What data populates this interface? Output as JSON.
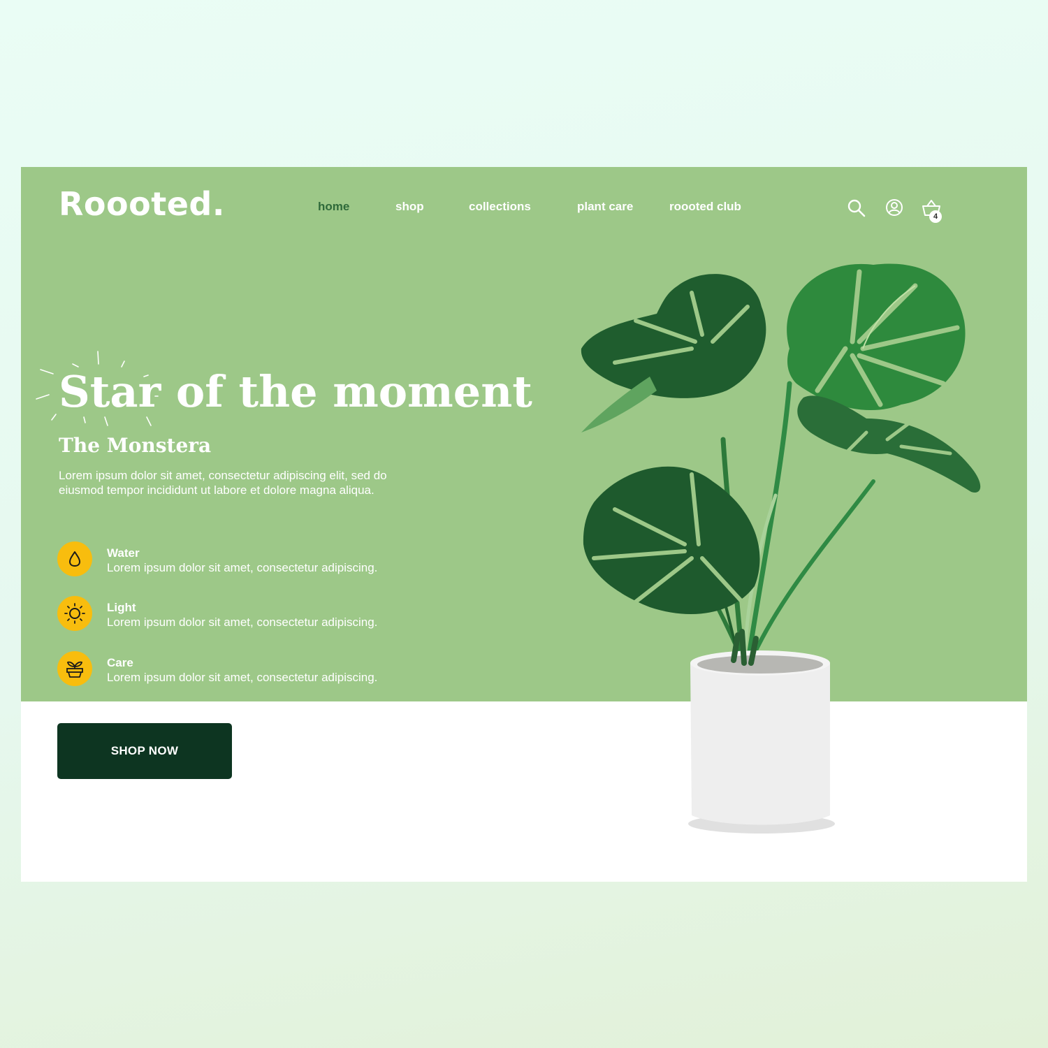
{
  "brand": {
    "logo": "Roooted."
  },
  "nav": {
    "items": [
      {
        "label": "home",
        "active": true
      },
      {
        "label": "shop"
      },
      {
        "label": "collections"
      },
      {
        "label": "plant care"
      },
      {
        "label": "roooted club"
      }
    ]
  },
  "header_icons": {
    "search": "search-icon",
    "account": "user-icon",
    "cart": "basket-icon",
    "cart_count": "4"
  },
  "hero": {
    "headline": "Star of the moment",
    "subheadline": "The Monstera",
    "description": "Lorem ipsum dolor sit amet, consectetur adipiscing elit, sed do eiusmod tempor incididunt ut labore et dolore magna aliqua.",
    "features": [
      {
        "icon": "water-drop-icon",
        "title": "Water",
        "text": "Lorem ipsum dolor sit amet, consectetur adipiscing."
      },
      {
        "icon": "sun-icon",
        "title": "Light",
        "text": "Lorem ipsum dolor sit amet, consectetur adipiscing."
      },
      {
        "icon": "plant-pot-icon",
        "title": "Care",
        "text": "Lorem ipsum dolor sit amet, consectetur adipiscing."
      }
    ],
    "cta_label": "SHOP NOW"
  },
  "colors": {
    "hero_background": "#9dc888",
    "accent_yellow": "#f8bd0e",
    "button_dark_green": "#0d3521",
    "active_nav": "#2f6a3a",
    "white": "#ffffff"
  }
}
